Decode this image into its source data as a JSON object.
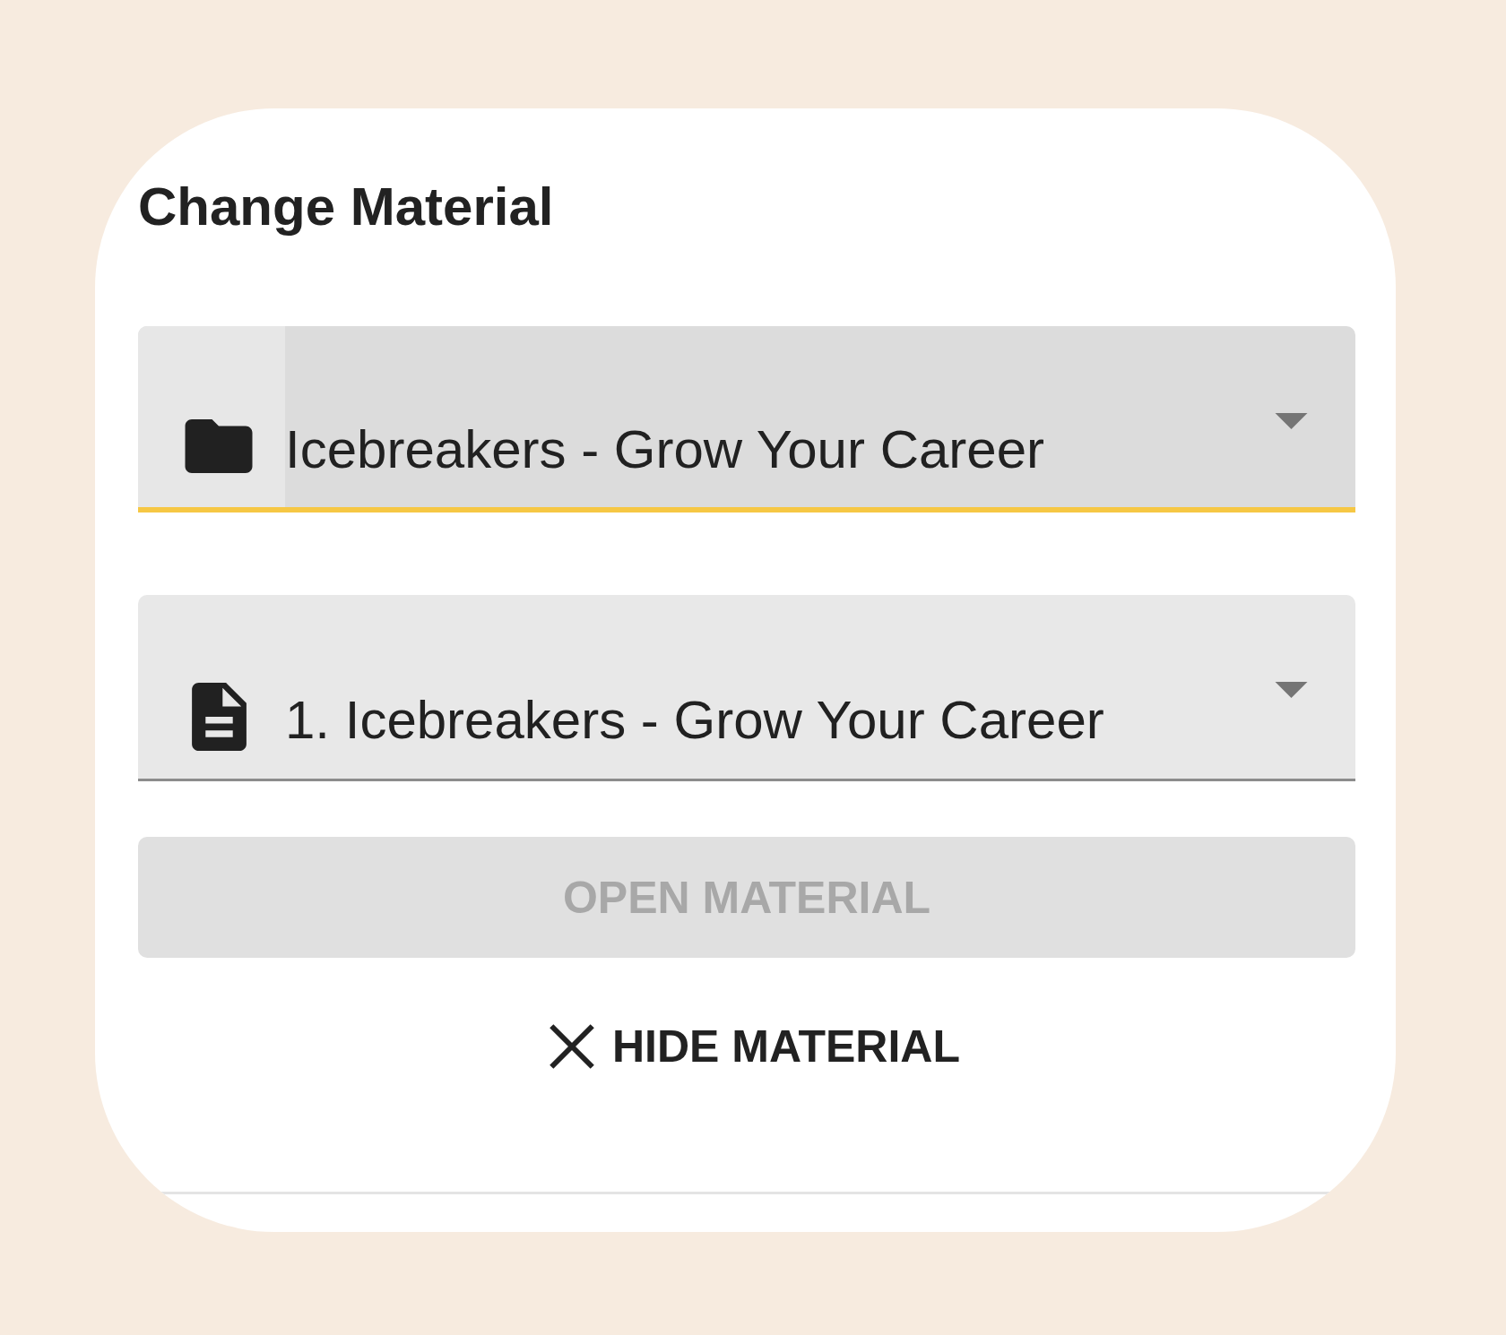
{
  "panel": {
    "title": "Change Material"
  },
  "selects": [
    {
      "kind": "folder",
      "value": "Icebreakers - Grow Your Career",
      "focused": true
    },
    {
      "kind": "document",
      "value": "1. Icebreakers - Grow Your Career",
      "focused": false
    }
  ],
  "open_button": {
    "label": "OPEN MATERIAL",
    "disabled": true
  },
  "hide_button": {
    "label": "HIDE MATERIAL"
  }
}
